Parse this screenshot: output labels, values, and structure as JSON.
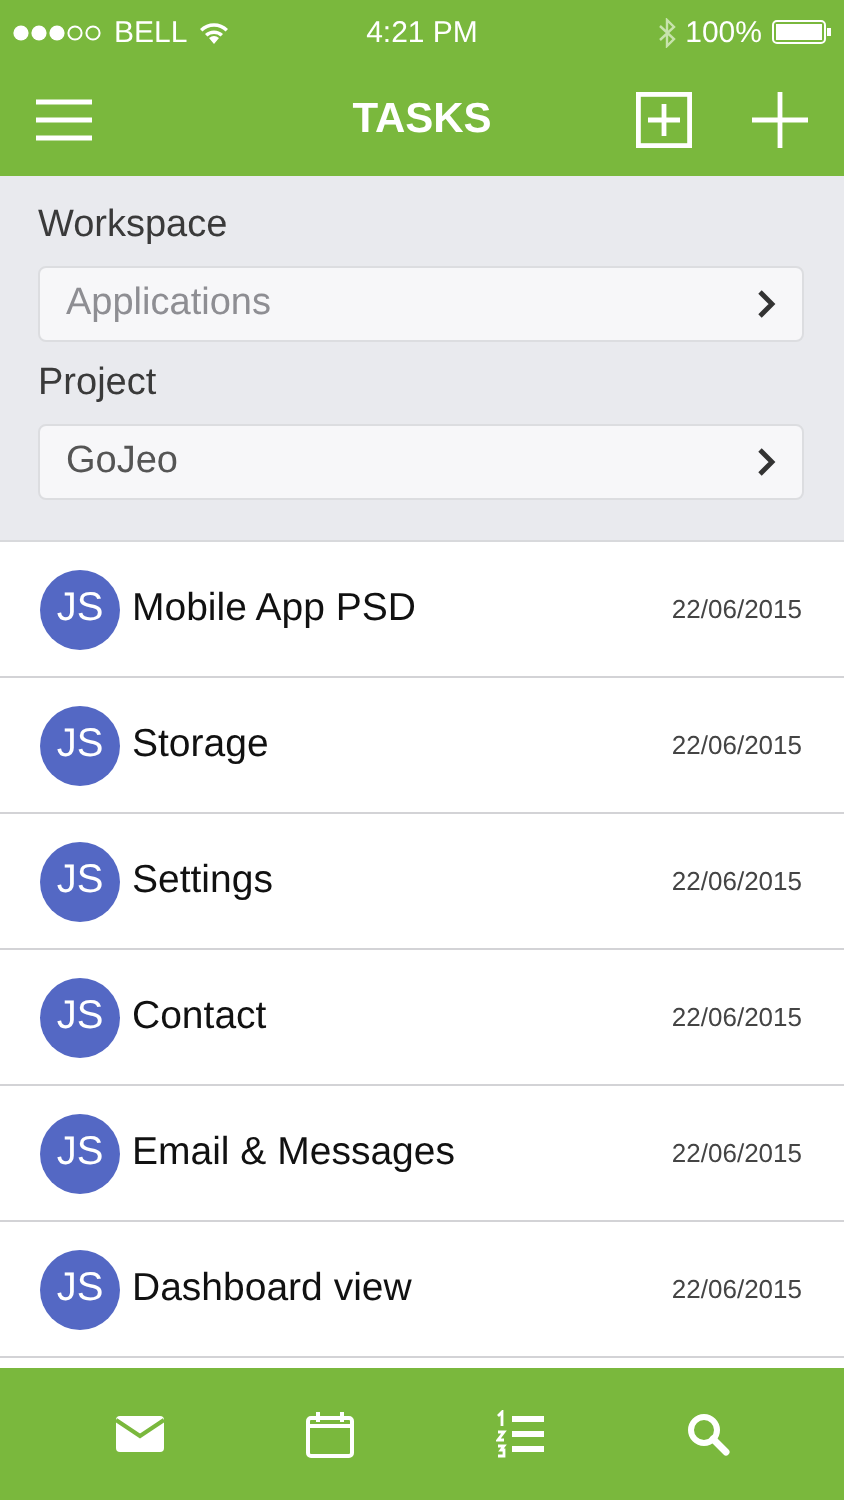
{
  "status_bar": {
    "carrier": "BELL",
    "time": "4:21 PM",
    "battery": "100%"
  },
  "nav": {
    "title": "TASKS"
  },
  "filters": [
    {
      "label": "Workspace",
      "value": "Applications",
      "placeholder_style": true
    },
    {
      "label": "Project",
      "value": "GoJeo",
      "placeholder_style": false
    }
  ],
  "tasks": [
    {
      "initials": "JS",
      "title": "Mobile App PSD",
      "date": "22/06/2015"
    },
    {
      "initials": "JS",
      "title": "Storage",
      "date": "22/06/2015"
    },
    {
      "initials": "JS",
      "title": "Settings",
      "date": "22/06/2015"
    },
    {
      "initials": "JS",
      "title": "Contact",
      "date": "22/06/2015"
    },
    {
      "initials": "JS",
      "title": "Email & Messages",
      "date": "22/06/2015"
    },
    {
      "initials": "JS",
      "title": "Dashboard view",
      "date": "22/06/2015"
    }
  ],
  "tab_bar": [
    {
      "kind": "mail"
    },
    {
      "kind": "calendar"
    },
    {
      "kind": "list"
    },
    {
      "kind": "search"
    }
  ]
}
